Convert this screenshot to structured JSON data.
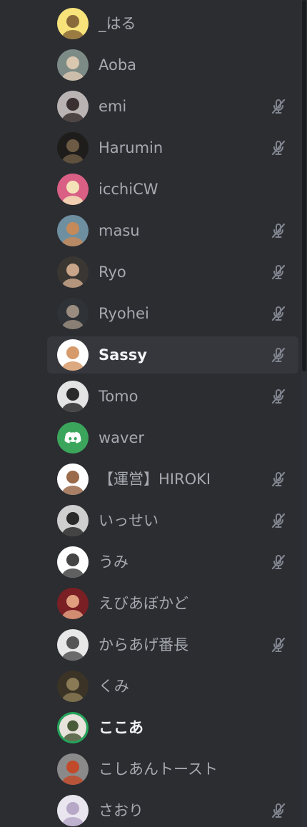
{
  "members": [
    {
      "name": "_はる",
      "muted": false,
      "avatar": "avatar-1",
      "bg": "#f7e37a",
      "fg": "#8a6a3a"
    },
    {
      "name": "Aoba",
      "muted": false,
      "avatar": "avatar-2",
      "bg": "#7d8b86",
      "fg": "#d9c7b0"
    },
    {
      "name": "emi",
      "muted": true,
      "avatar": "avatar-3",
      "bg": "#b9b3b3",
      "fg": "#3a3030"
    },
    {
      "name": "Harumin",
      "muted": true,
      "avatar": "avatar-4",
      "bg": "#1f1d1b",
      "fg": "#6c5a45"
    },
    {
      "name": "icchiCW",
      "muted": false,
      "avatar": "avatar-5",
      "bg": "#d95f85",
      "fg": "#f4e3b8"
    },
    {
      "name": "masu",
      "muted": true,
      "avatar": "avatar-6",
      "bg": "#6e8fa0",
      "fg": "#c48a5a"
    },
    {
      "name": "Ryo",
      "muted": true,
      "avatar": "avatar-7",
      "bg": "#3a3733",
      "fg": "#c9a58a"
    },
    {
      "name": "Ryohei",
      "muted": true,
      "avatar": "avatar-8",
      "bg": "#2f3236",
      "fg": "#9a8d80"
    },
    {
      "name": "Sassy",
      "muted": true,
      "avatar": "avatar-9",
      "bg": "#ffffff",
      "fg": "#d79a6a",
      "hover": true,
      "bright": true
    },
    {
      "name": "Tomo",
      "muted": true,
      "avatar": "avatar-10",
      "bg": "#e4e4e4",
      "fg": "#2b2a2a"
    },
    {
      "name": "waver",
      "muted": false,
      "avatar": "discord-logo-icon",
      "bg": "#3ba55c",
      "fg": "#ffffff"
    },
    {
      "name": "【運営】HIROKI",
      "muted": true,
      "avatar": "avatar-12",
      "bg": "#ffffff",
      "fg": "#9a6a4a"
    },
    {
      "name": "いっせい",
      "muted": true,
      "avatar": "avatar-13",
      "bg": "#cfcfcf",
      "fg": "#2a2a2a"
    },
    {
      "name": "うみ",
      "muted": true,
      "avatar": "avatar-14",
      "bg": "#ffffff",
      "fg": "#444444"
    },
    {
      "name": "えびあぼかど",
      "muted": false,
      "avatar": "avatar-15",
      "bg": "#7a1f24",
      "fg": "#e0a080"
    },
    {
      "name": "からあげ番長",
      "muted": true,
      "avatar": "avatar-16",
      "bg": "#e8e8e8",
      "fg": "#555555"
    },
    {
      "name": "くみ",
      "muted": false,
      "avatar": "avatar-17",
      "bg": "#3b3426",
      "fg": "#8a7a55"
    },
    {
      "name": "ここあ",
      "muted": false,
      "avatar": "avatar-18",
      "bg": "#e8e3dc",
      "fg": "#4a5b3a",
      "speaking": true,
      "bright": true
    },
    {
      "name": "こしあんトースト",
      "muted": false,
      "avatar": "avatar-19",
      "bg": "#8a8a8a",
      "fg": "#c04a2a"
    },
    {
      "name": "さおり",
      "muted": true,
      "avatar": "avatar-20",
      "bg": "#e9e6f0",
      "fg": "#b7a8c8"
    }
  ],
  "colors": {
    "background": "#2b2d31",
    "hover": "#35373c",
    "text": "#a6a9b0",
    "text_bright": "#f2f3f5",
    "speaking_ring": "#23a55a",
    "mute_icon": "#80848e"
  }
}
